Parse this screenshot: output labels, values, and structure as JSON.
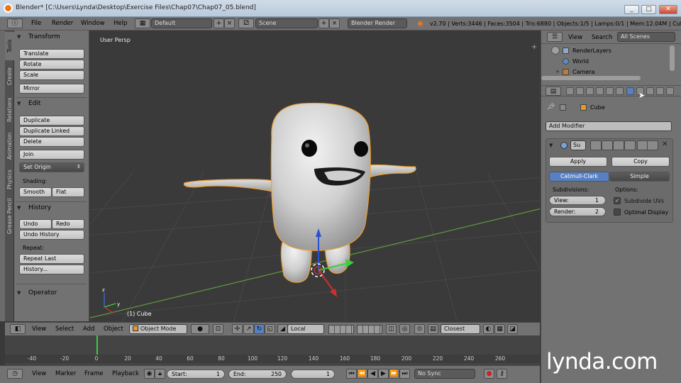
{
  "window": {
    "title": "Blender* [C:\\Users\\Lynda\\Desktop\\Exercise Files\\Chap07\\Chap07_05.blend]",
    "minimize": "_",
    "maximize": "□",
    "close": "✕"
  },
  "topbar": {
    "menus": [
      "File",
      "Render",
      "Window",
      "Help"
    ],
    "layout": "Default",
    "scene": "Scene",
    "engine": "Blender Render",
    "stats": "v2.70 | Verts:3446 | Faces:3504 | Tris:6880 | Objects:1/5 | Lamps:0/1 | Mem:12.04M | Cube"
  },
  "left_tabs": [
    "Tools",
    "Create",
    "Relations",
    "Animation",
    "Physics",
    "Grease Pencil"
  ],
  "toolshelf": {
    "transform": {
      "title": "Transform",
      "buttons": [
        "Translate",
        "Rotate",
        "Scale"
      ],
      "mirror": "Mirror"
    },
    "edit": {
      "title": "Edit",
      "buttons": [
        "Duplicate",
        "Duplicate Linked",
        "Delete"
      ],
      "join": "Join",
      "set_origin": "Set Origin",
      "shading_label": "Shading:",
      "smooth": "Smooth",
      "flat": "Flat"
    },
    "history": {
      "title": "History",
      "undo": "Undo",
      "redo": "Redo",
      "undo_history": "Undo History",
      "repeat_label": "Repeat:",
      "repeat_last": "Repeat Last",
      "history_btn": "History..."
    },
    "operator": {
      "title": "Operator"
    }
  },
  "viewport": {
    "label": "User Persp",
    "object_label": "(1) Cube"
  },
  "vp_header": {
    "menus": [
      "View",
      "Select",
      "Add",
      "Object"
    ],
    "mode": "Object Mode",
    "pivot": "Local",
    "snap": "Closest"
  },
  "timeline": {
    "ticks": [
      "-40",
      "-20",
      "0",
      "20",
      "40",
      "60",
      "80",
      "100",
      "120",
      "140",
      "160",
      "180",
      "200",
      "220",
      "240",
      "260"
    ],
    "current_frame_marker": 0,
    "footer_menus": [
      "View",
      "Marker",
      "Frame",
      "Playback"
    ],
    "start": "Start:",
    "start_val": "1",
    "end": "End:",
    "end_val": "250",
    "frame_val": "1",
    "sync": "No Sync"
  },
  "outliner": {
    "menus": [
      "View",
      "Search"
    ],
    "filter": "All Scenes",
    "items": [
      "RenderLayers",
      "World",
      "Camera"
    ]
  },
  "properties": {
    "breadcrumb": "Cube",
    "add_modifier": "Add Modifier",
    "modifier": {
      "name": "Su",
      "apply": "Apply",
      "copy": "Copy",
      "mode_a": "Catmull-Clark",
      "mode_b": "Simple",
      "subdivisions_label": "Subdivisions:",
      "view_label": "View:",
      "view_val": "1",
      "render_label": "Render:",
      "render_val": "2",
      "options_label": "Options:",
      "subdivide_uvs": "Subdivide UVs",
      "subdivide_uvs_checked": true,
      "optimal_display": "Optimal Display",
      "optimal_display_checked": false
    }
  },
  "watermark": "lynda.com",
  "colors": {
    "accent": "#5680c2",
    "panel": "#727272",
    "viewport": "#3a3a3a",
    "selection_outline": "#f0a030"
  }
}
